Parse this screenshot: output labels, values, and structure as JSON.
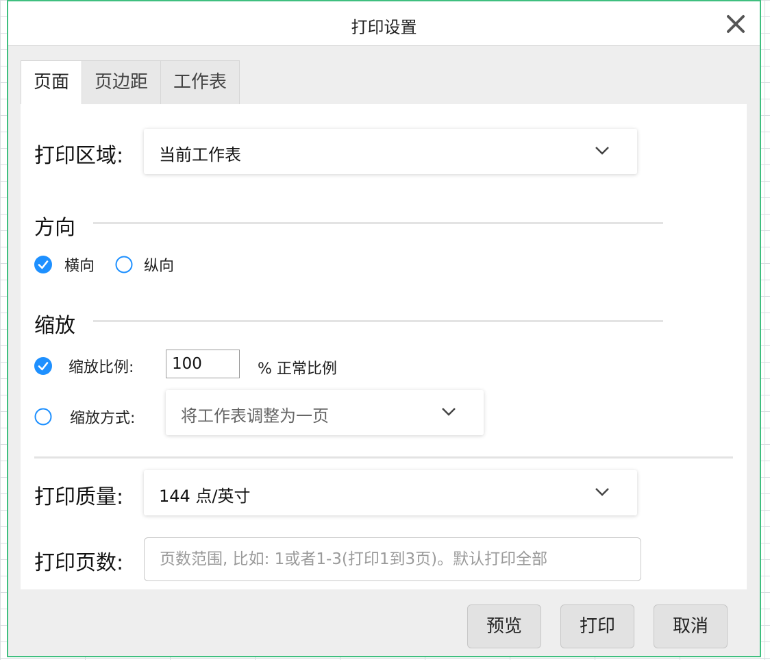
{
  "dialog": {
    "title": "打印设置",
    "close_icon": "close-icon"
  },
  "tabs": [
    {
      "label": "页面",
      "active": true
    },
    {
      "label": "页边距",
      "active": false
    },
    {
      "label": "工作表",
      "active": false
    }
  ],
  "print_area": {
    "label": "打印区域:",
    "value": "当前工作表"
  },
  "orientation": {
    "title": "方向",
    "options": [
      {
        "label": "横向",
        "checked": true
      },
      {
        "label": "纵向",
        "checked": false
      }
    ]
  },
  "scale": {
    "title": "缩放",
    "ratio_label": "缩放比例:",
    "ratio_value": "100",
    "ratio_suffix": "% 正常比例",
    "ratio_checked": true,
    "mode_label": "缩放方式:",
    "mode_value": "将工作表调整为一页",
    "mode_checked": false
  },
  "quality": {
    "label": "打印质量:",
    "value": "144 点/英寸"
  },
  "pages": {
    "label": "打印页数:",
    "placeholder": "页数范围, 比如: 1或者1-3(打印1到3页)。默认打印全部"
  },
  "buttons": {
    "preview": "预览",
    "print": "打印",
    "cancel": "取消"
  },
  "colors": {
    "accent": "#1e90ff",
    "dialog_border": "#3fbf7f"
  }
}
